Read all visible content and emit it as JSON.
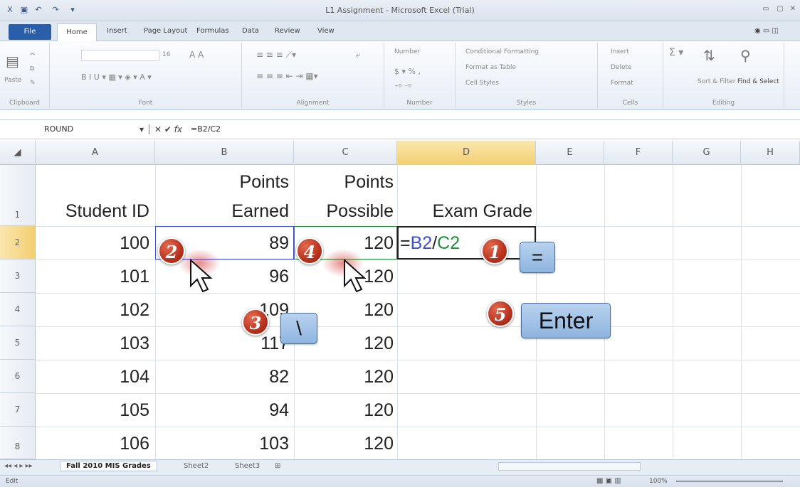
{
  "window": {
    "title": "L1 Assignment - Microsoft Excel (Trial)"
  },
  "ribbon": {
    "tabs": [
      "File",
      "Home",
      "Insert",
      "Page Layout",
      "Formulas",
      "Data",
      "Review",
      "View"
    ],
    "groups": [
      "Clipboard",
      "Font",
      "Alignment",
      "Number",
      "Styles",
      "Cells",
      "Editing"
    ],
    "paste_label": "Paste",
    "font_size": "16",
    "number_format": "Number",
    "styles": [
      "Conditional Formatting",
      "Format as Table",
      "Cell Styles"
    ],
    "cells": [
      "Insert",
      "Delete",
      "Format"
    ],
    "editing": [
      "Sort & Filter",
      "Find & Select"
    ]
  },
  "formula_bar": {
    "name_box": "ROUND",
    "fx": "fx",
    "formula": "=B2/C2"
  },
  "sheet": {
    "columns": [
      "A",
      "B",
      "C",
      "D",
      "E",
      "F",
      "G",
      "H"
    ],
    "rows": [
      "1",
      "2",
      "3",
      "4",
      "5",
      "6",
      "7",
      "8"
    ],
    "header": {
      "a": "Student ID",
      "b1": "Points",
      "b2": "Earned",
      "c1": "Points",
      "c2": "Possible",
      "d": "Exam Grade"
    },
    "data": [
      {
        "id": "100",
        "earned": "89",
        "possible": "120"
      },
      {
        "id": "101",
        "earned": "96",
        "possible": "120"
      },
      {
        "id": "102",
        "earned": "109",
        "possible": "120"
      },
      {
        "id": "103",
        "earned": "117",
        "possible": "120"
      },
      {
        "id": "104",
        "earned": "82",
        "possible": "120"
      },
      {
        "id": "105",
        "earned": "94",
        "possible": "120"
      },
      {
        "id": "106",
        "earned": "103",
        "possible": "120"
      }
    ],
    "edit_cell": {
      "eq": "=",
      "ref1": "B2",
      "slash": "/",
      "ref2": "C2"
    }
  },
  "annotations": {
    "steps": [
      "1",
      "2",
      "3",
      "4",
      "5"
    ],
    "key_equals": "=",
    "key_backslash": "\\",
    "key_enter": "Enter"
  },
  "sheet_tabs": [
    "Fall 2010 MIS Grades",
    "Sheet2",
    "Sheet3"
  ],
  "status": {
    "mode": "Edit",
    "zoom": "100%"
  },
  "colors": {
    "ref_blue": "#3b4fd8",
    "ref_green": "#1f8f3a",
    "selected_col": "#f7d37a",
    "badge": "#b8321e",
    "key": "#9dbfe6"
  }
}
